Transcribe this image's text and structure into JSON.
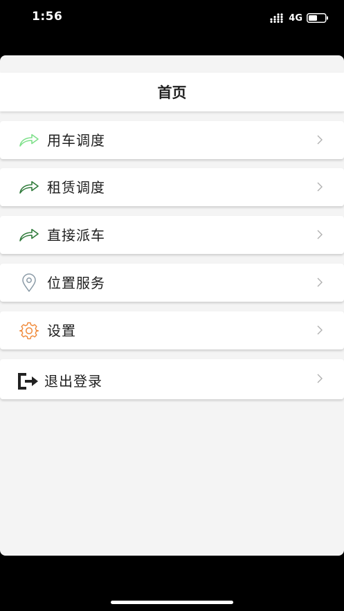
{
  "status_bar": {
    "time": "1:56",
    "network": "4G",
    "icons": [
      "signal-icon",
      "battery-icon"
    ]
  },
  "header": {
    "title": "首页"
  },
  "menu": {
    "items": [
      {
        "label": "用车调度",
        "icon": "share-arrow-icon",
        "icon_color": "#7ee08a"
      },
      {
        "label": "租赁调度",
        "icon": "share-arrow-icon",
        "icon_color": "#2f7a3a"
      },
      {
        "label": "直接派车",
        "icon": "share-arrow-icon",
        "icon_color": "#2f7a3a"
      },
      {
        "label": "位置服务",
        "icon": "location-pin-icon",
        "icon_color": "#8a9aa6"
      },
      {
        "label": "设置",
        "icon": "gear-icon",
        "icon_color": "#f08a3a"
      },
      {
        "label": "退出登录",
        "icon": "logout-icon",
        "icon_color": "#222222"
      }
    ]
  },
  "colors": {
    "panel_background": "#f4f4f4",
    "item_background": "#ffffff",
    "chevron": "#b0b0b0"
  }
}
